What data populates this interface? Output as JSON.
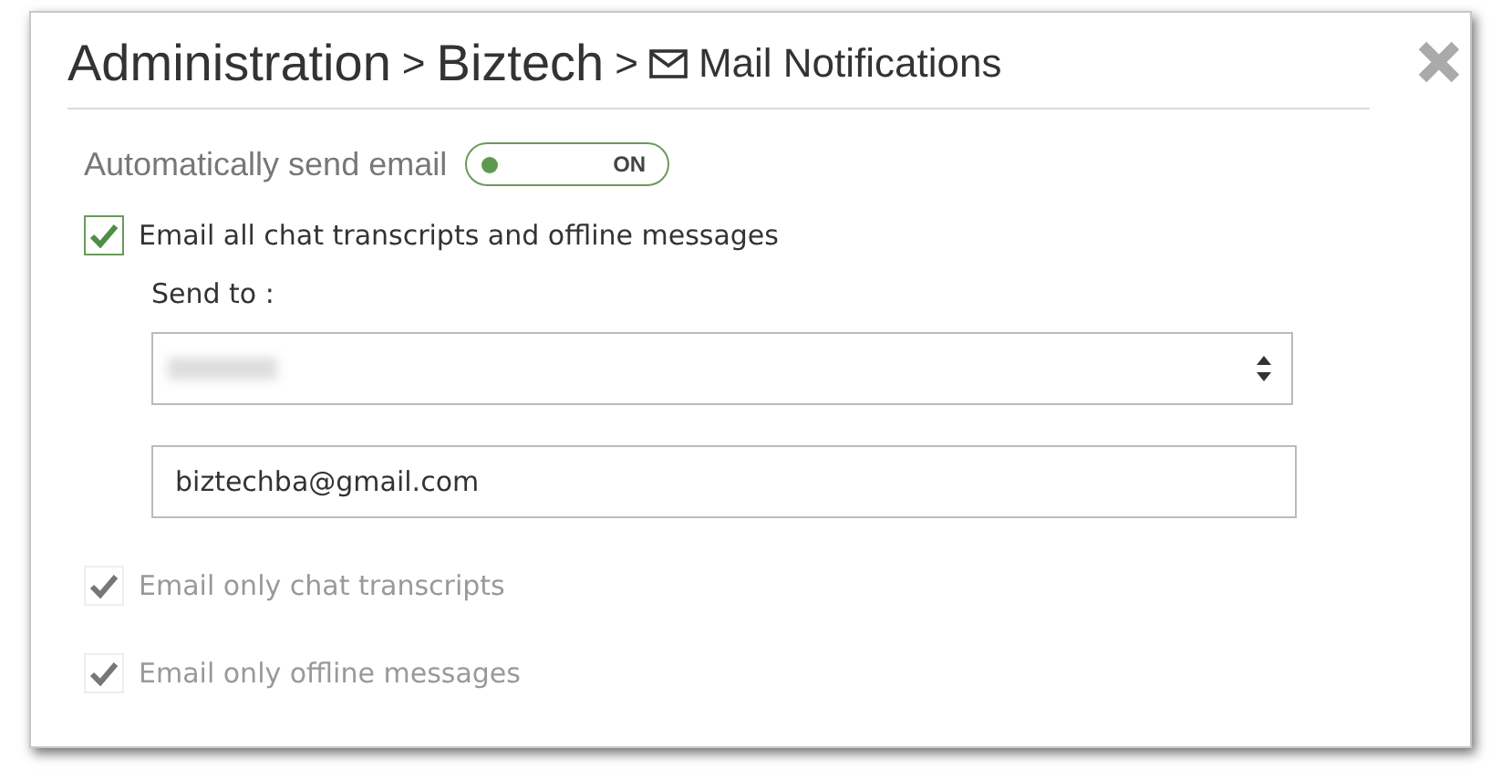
{
  "breadcrumb": {
    "items": [
      {
        "label": "Administration",
        "kind": "link"
      },
      {
        "label": "Biztech",
        "kind": "link"
      },
      {
        "label": "Mail Notifications",
        "kind": "current"
      }
    ],
    "separators": [
      ">",
      ">"
    ]
  },
  "auto_send": {
    "label": "Automatically send email",
    "on": true,
    "state_text": "ON"
  },
  "options": [
    {
      "label": "Email all chat transcripts and offline messages",
      "checked": true,
      "disabled": false
    },
    {
      "label": "Email only chat transcripts",
      "checked": true,
      "disabled": true
    },
    {
      "label": "Email only offline messages",
      "checked": true,
      "disabled": true
    }
  ],
  "send_to": {
    "label": "Send to :",
    "email": {
      "value": "biztechba@gmail.com"
    }
  }
}
